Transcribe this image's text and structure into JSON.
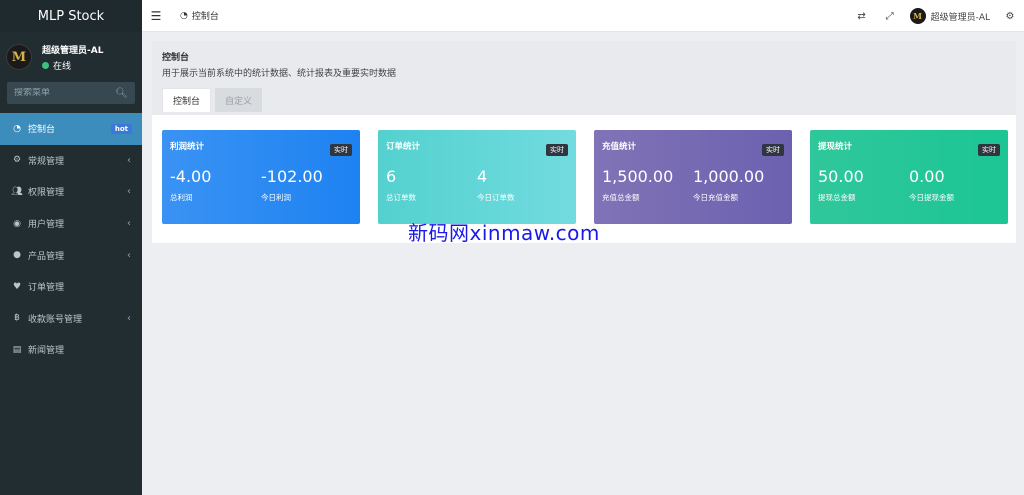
{
  "sidebar": {
    "brand": "MLP Stock",
    "user_name": "超级管理员-AL",
    "status": "在线",
    "avatar_letter": "M",
    "search_placeholder": "搜索菜单",
    "items": [
      {
        "label": "控制台",
        "icon": "dashboard-icon",
        "badge": "hot",
        "active": true
      },
      {
        "label": "常规管理",
        "icon": "cogs-icon"
      },
      {
        "label": "权限管理",
        "icon": "users-icon"
      },
      {
        "label": "用户管理",
        "icon": "user-circle-icon"
      },
      {
        "label": "产品管理",
        "icon": "product-icon"
      },
      {
        "label": "订单管理",
        "icon": "heartbeat-icon"
      },
      {
        "label": "收款账号管理",
        "icon": "bitcoin-icon"
      },
      {
        "label": "新闻管理",
        "icon": "newspaper-icon"
      }
    ]
  },
  "header": {
    "tab_label": "控制台",
    "user_name": "超级管理员-AL"
  },
  "page": {
    "title": "控制台",
    "description": "用于展示当前系统中的统计数据、统计报表及重要实时数据",
    "tabs": [
      "控制台",
      "自定义"
    ]
  },
  "cards": [
    {
      "title": "利润统计",
      "badge": "实时",
      "v1": "-4.00",
      "l1": "总利润",
      "v2": "-102.00",
      "l2": "今日利润",
      "color": "#2a8bf2"
    },
    {
      "title": "订单统计",
      "badge": "实时",
      "v1": "6",
      "l1": "总订单数",
      "v2": "4",
      "l2": "今日订单数",
      "color": "#5fd4d4"
    },
    {
      "title": "充值统计",
      "badge": "实时",
      "v1": "1,500.00",
      "l1": "充值总金额",
      "v2": "1,000.00",
      "l2": "今日充值金额",
      "color": "#766ab4"
    },
    {
      "title": "提现统计",
      "badge": "实时",
      "v1": "50.00",
      "l1": "提现总金额",
      "v2": "0.00",
      "l2": "今日提现金额",
      "color": "#24c698"
    }
  ],
  "watermark": "新码网xinmaw.com"
}
